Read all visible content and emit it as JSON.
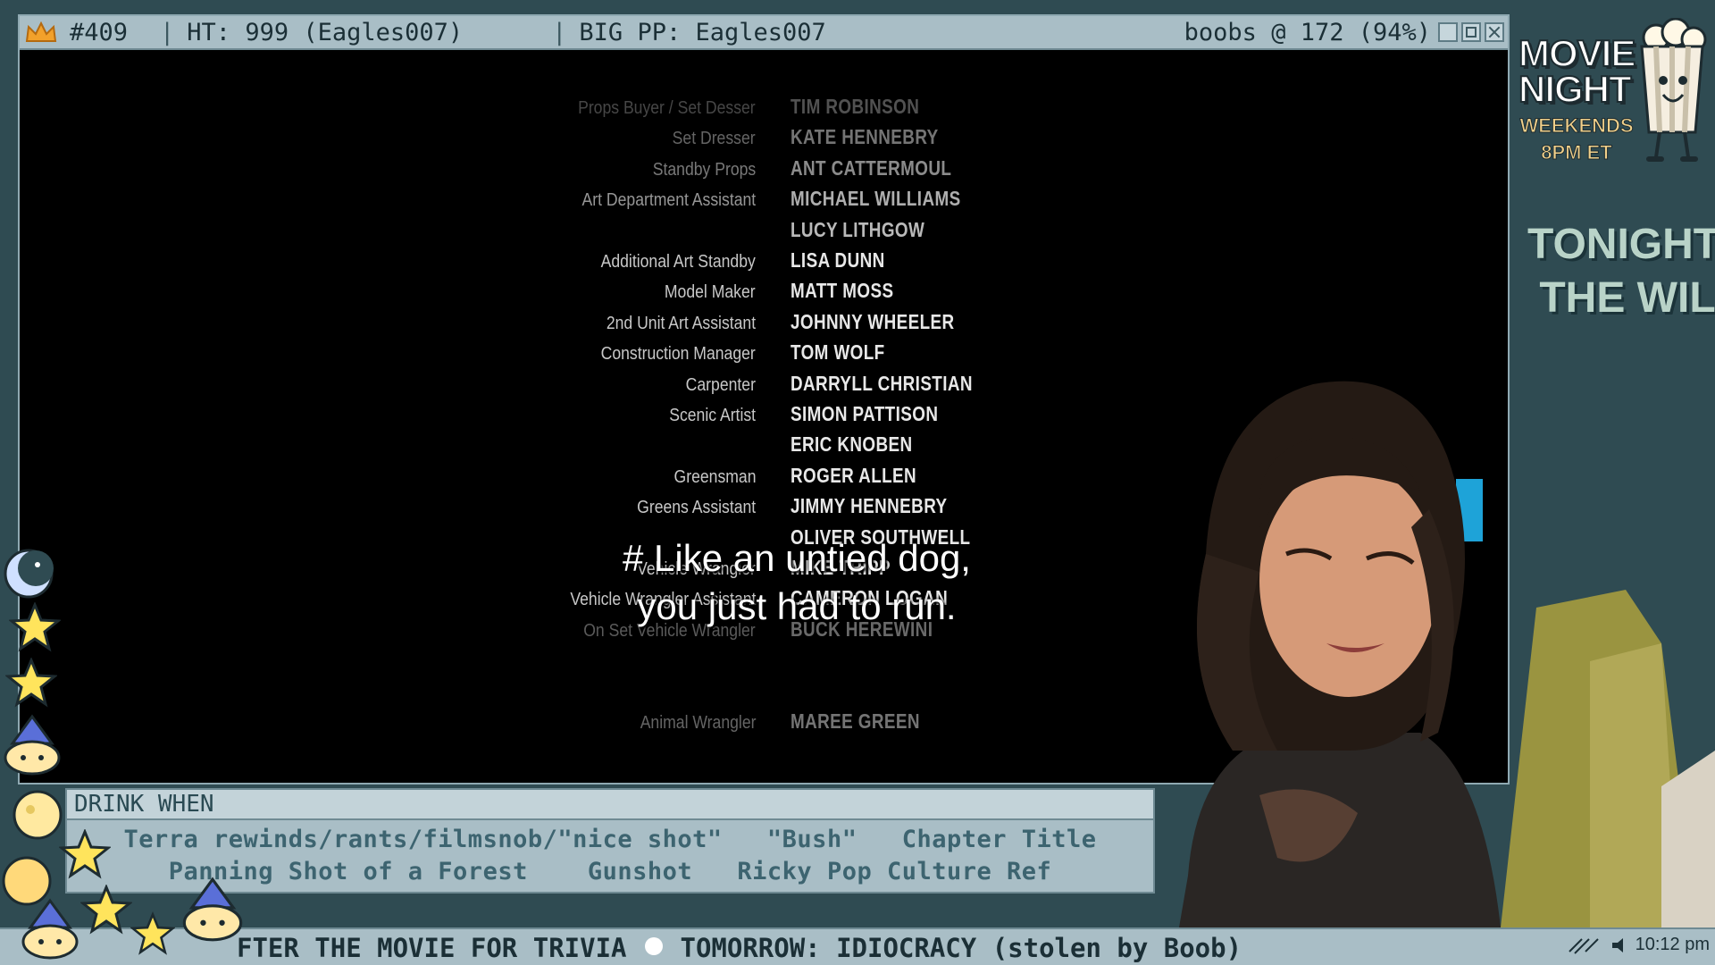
{
  "titlebar": {
    "counter": "#409",
    "ht": "HT: 999 (Eagles007)",
    "big_pp": "BIG PP: Eagles007",
    "status": "boobs @ 172 (94%)",
    "separator": "|"
  },
  "credits": [
    {
      "role": "Props Buyer / Set Desser",
      "name": "TIM ROBINSON"
    },
    {
      "role": "Set Dresser",
      "name": "KATE HENNEBRY"
    },
    {
      "role": "Standby Props",
      "name": "ANT CATTERMOUL"
    },
    {
      "role": "Art Department Assistant",
      "name": "MICHAEL WILLIAMS"
    },
    {
      "role": "",
      "name": "LUCY LITHGOW"
    },
    {
      "role": "Additional Art Standby",
      "name": "LISA DUNN"
    },
    {
      "role": "Model Maker",
      "name": "MATT MOSS"
    },
    {
      "role": "2nd Unit Art Assistant",
      "name": "JOHNNY WHEELER"
    },
    {
      "role": "Construction Manager",
      "name": "TOM WOLF"
    },
    {
      "role": "Carpenter",
      "name": "DARRYLL CHRISTIAN"
    },
    {
      "role": "Scenic Artist",
      "name": "SIMON PATTISON"
    },
    {
      "role": "",
      "name": "ERIC KNOBEN"
    },
    {
      "role": "Greensman",
      "name": "ROGER ALLEN"
    },
    {
      "role": "Greens Assistant",
      "name": "JIMMY HENNEBRY"
    },
    {
      "role": "",
      "name": "OLIVER SOUTHWELL"
    },
    {
      "role": "Vehicle Wrangler",
      "name": "MIKE TRIPP"
    },
    {
      "role": "Vehicle Wrangler Assistant",
      "name": "CAMERON LOGAN"
    },
    {
      "role": "On Set Vehicle Wrangler",
      "name": "BUCK HEREWINI"
    },
    {
      "role": "",
      "name": ""
    },
    {
      "role": "",
      "name": ""
    },
    {
      "role": "Animal Wrangler",
      "name": "MAREE GREEN"
    }
  ],
  "subtitle": {
    "line1": "# Like an untied dog,",
    "line2": "you just had to run."
  },
  "drink_panel": {
    "header": "DRINK WHEN",
    "line1": "Terra rewinds/rants/filmsnob/\"nice shot\"   \"Bush\"   Chapter Title",
    "line2": "Panning Shot of a Forest    Gunshot   Ricky Pop Culture Ref"
  },
  "ticker": {
    "part1": "FTER THE MOVIE FOR TRIVIA",
    "part2": "TOMORROW: IDIOCRACY (stolen by Boob)"
  },
  "tray": {
    "time": "10:12 pm"
  },
  "sidebar": {
    "movie_night": "MOVIE NIGHT",
    "when1": "WEEKENDS",
    "when2": "8PM ET",
    "tonight1": "TONIGHT:",
    "tonight2": " THE WIL"
  },
  "colors": {
    "frame": "#a9bec6",
    "background": "#2f4b52",
    "drink_text": "#3d6470"
  }
}
